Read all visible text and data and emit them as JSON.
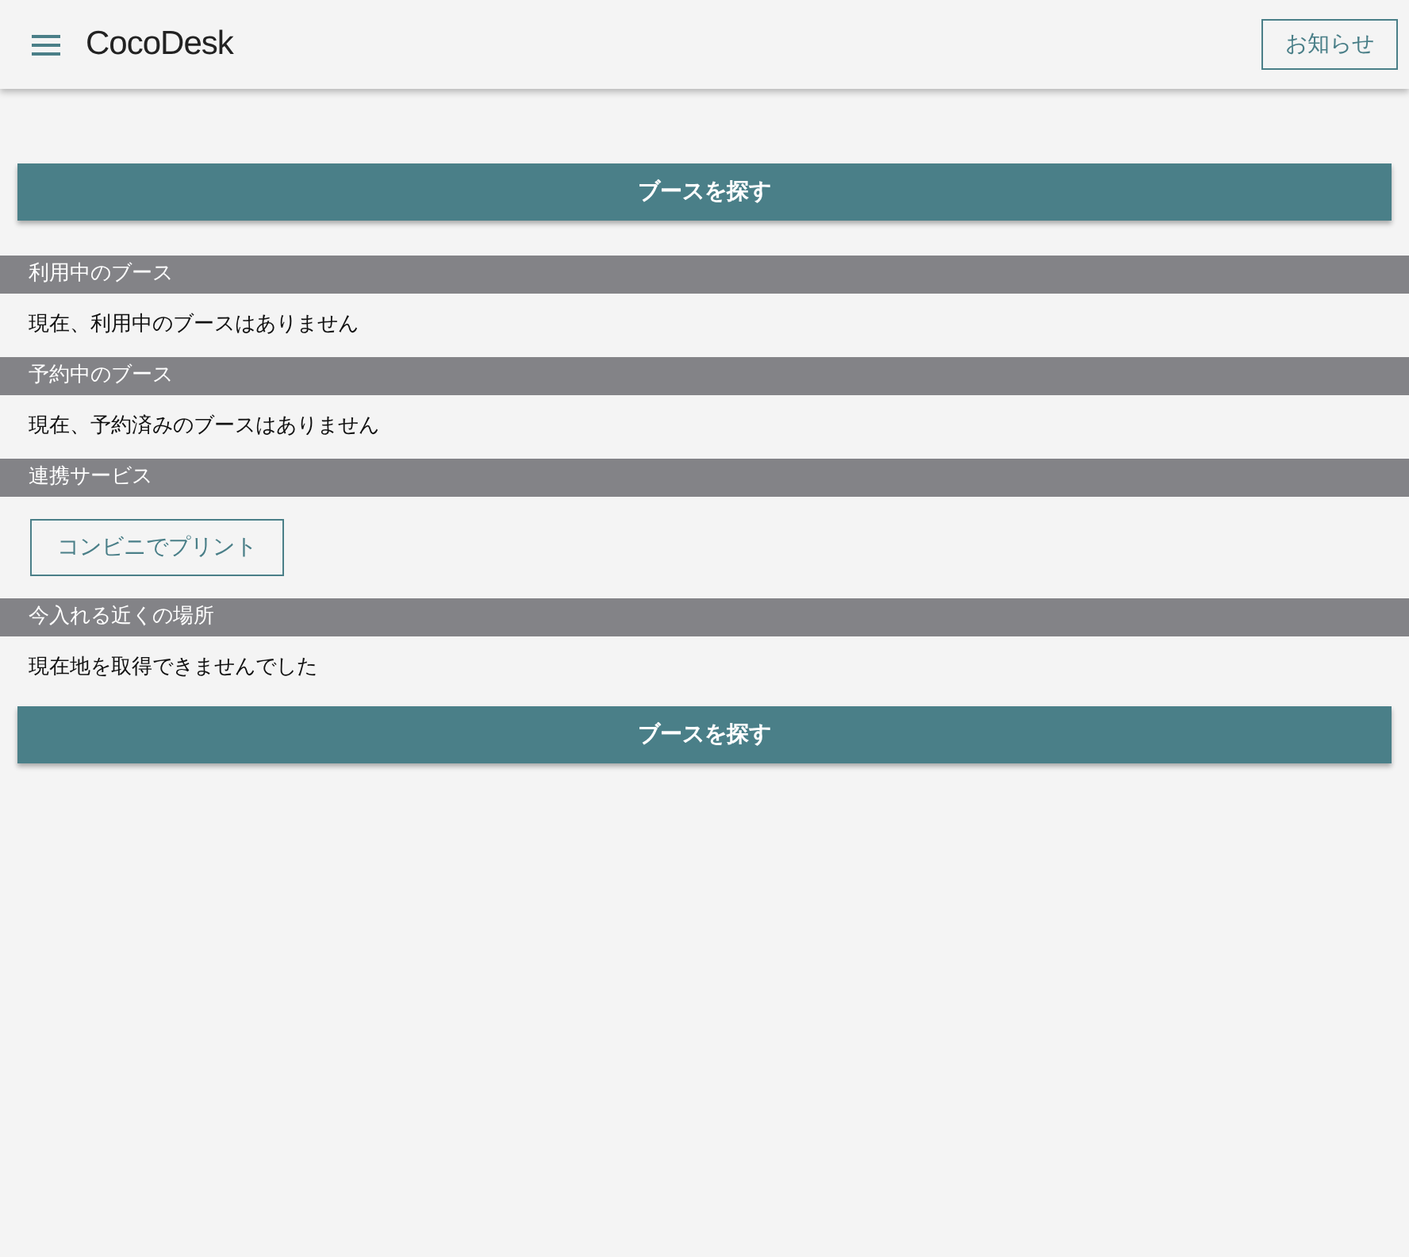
{
  "header": {
    "logo": "CocoDesk",
    "notice_button": "お知らせ"
  },
  "top_button": "ブースを探す",
  "sections": [
    {
      "title": "利用中のブース",
      "kind": "text",
      "text": "現在、利用中のブースはありません"
    },
    {
      "title": "予約中のブース",
      "kind": "text",
      "text": "現在、予約済みのブースはありません"
    },
    {
      "title": "連携サービス",
      "kind": "button",
      "text": "コンビニでプリント"
    },
    {
      "title": "今入れる近くの場所",
      "kind": "text",
      "text": "現在地を取得できませんでした"
    }
  ],
  "bottom_button": "ブースを探す"
}
